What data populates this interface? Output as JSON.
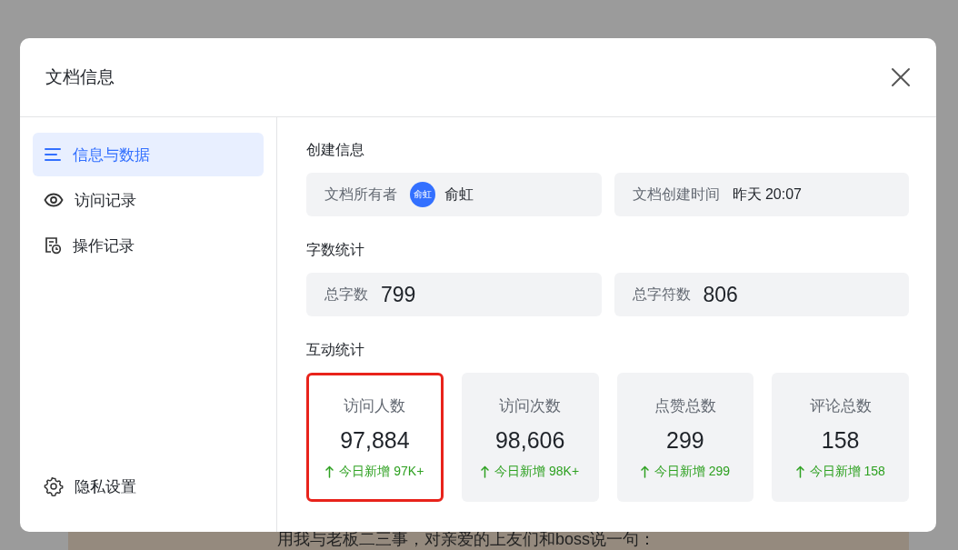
{
  "document": {
    "body_line": "用我与老板二三事，对亲爱的上友们和boss说一句："
  },
  "dialog": {
    "title": "文档信息",
    "sidebar": {
      "items": [
        {
          "label": "信息与数据",
          "selected": true
        },
        {
          "label": "访问记录",
          "selected": false
        },
        {
          "label": "操作记录",
          "selected": false
        }
      ],
      "footer": {
        "label": "隐私设置"
      }
    },
    "sections": [
      {
        "title": "创建信息",
        "kind": "fields",
        "fields": [
          {
            "label": "文档所有者",
            "avatar": "俞虹",
            "value": "俞虹"
          },
          {
            "label": "文档创建时间",
            "value": "昨天 20:07"
          }
        ]
      },
      {
        "title": "字数统计",
        "kind": "counts",
        "fields": [
          {
            "label": "总字数",
            "value": "799"
          },
          {
            "label": "总字符数",
            "value": "806"
          }
        ]
      },
      {
        "title": "互动统计",
        "kind": "stats",
        "cards": [
          {
            "label": "访问人数",
            "value": "97,884",
            "delta": "今日新增 97K+",
            "highlighted": true
          },
          {
            "label": "访问次数",
            "value": "98,606",
            "delta": "今日新增 98K+",
            "highlighted": false
          },
          {
            "label": "点赞总数",
            "value": "299",
            "delta": "今日新增 299",
            "highlighted": false
          },
          {
            "label": "评论总数",
            "value": "158",
            "delta": "今日新增 158",
            "highlighted": false
          }
        ]
      }
    ]
  }
}
